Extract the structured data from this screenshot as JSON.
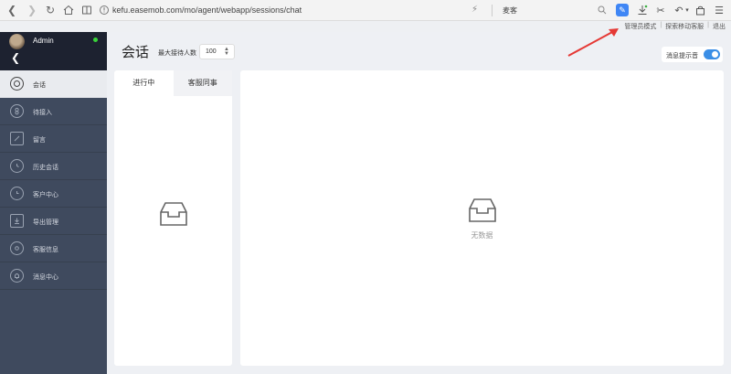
{
  "browser": {
    "url": "kefu.easemob.com/mo/agent/webapp/sessions/chat",
    "search_text": "麦客"
  },
  "top_links": {
    "admin_mode": "管理员模式",
    "explore_mobile": "探索移动客服",
    "logout": "退出"
  },
  "profile": {
    "name": "Admin",
    "status_color": "#39d339"
  },
  "sidebar": {
    "items": [
      {
        "label": "会话",
        "icon": "chat-icon",
        "active": true
      },
      {
        "label": "待接入",
        "icon": "queue-icon"
      },
      {
        "label": "留言",
        "icon": "message-icon"
      },
      {
        "label": "历史会话",
        "icon": "history-icon"
      },
      {
        "label": "客户中心",
        "icon": "customer-icon"
      },
      {
        "label": "导出管理",
        "icon": "download-icon"
      },
      {
        "label": "客服信息",
        "icon": "settings-icon"
      },
      {
        "label": "消息中心",
        "icon": "bell-icon"
      }
    ]
  },
  "main": {
    "title": "会话",
    "max_wait_label": "最大接待人数",
    "max_wait_value": "100",
    "notify_label": "消息提示音",
    "tabs": [
      "进行中",
      "客服同事"
    ],
    "empty_text": "无数据"
  },
  "colors": {
    "sidebar_bg": "#3f4a5e",
    "profile_bg": "#1d2230",
    "accent": "#3a8ee6",
    "annotation_arrow": "#e53935"
  }
}
